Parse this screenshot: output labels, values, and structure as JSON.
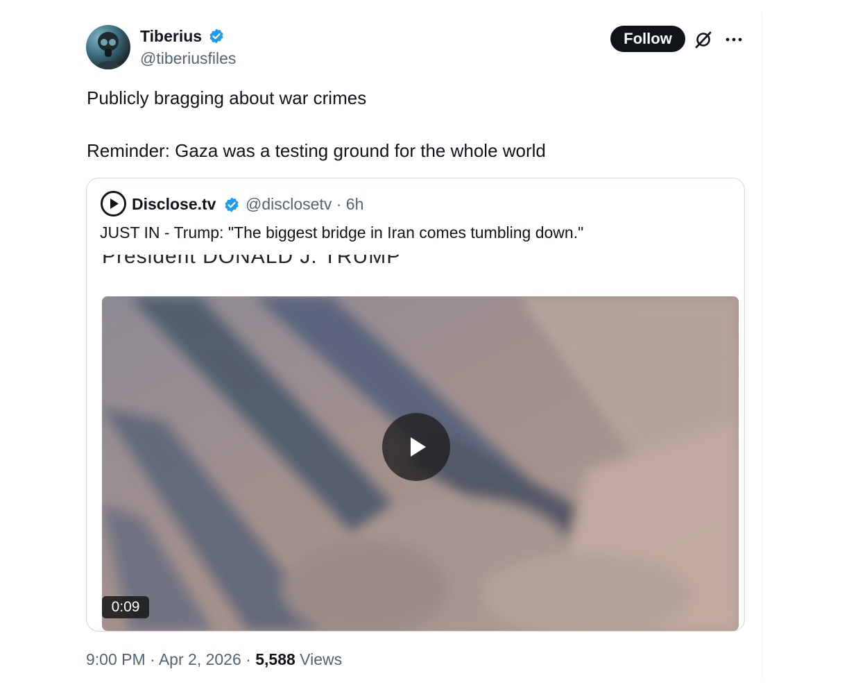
{
  "author": {
    "display_name": "Tiberius",
    "handle": "@tiberiusfiles",
    "verified": true,
    "avatar_icon": "gas-mask-avatar"
  },
  "header_actions": {
    "follow_label": "Follow",
    "grok_icon": "grok-icon",
    "more_icon": "more-dots-icon"
  },
  "tweet": {
    "text_line1": "Publicly bragging about war crimes",
    "text_line2": "Reminder: Gaza was a testing ground for the whole world"
  },
  "quote": {
    "display_name": "Disclose.tv",
    "handle": "@disclosetv",
    "separator": "·",
    "time": "6h",
    "verified": true,
    "text": "JUST IN - Trump: \"The biggest bridge in Iran comes tumbling down.\"",
    "video_caption": "President DONALD J. TRUMP",
    "video_duration": "0:09"
  },
  "footer": {
    "time": "9:00 PM",
    "separator": "·",
    "date": "Apr 2, 2026",
    "views_count": "5,588",
    "views_label": "Views"
  },
  "colors": {
    "verified_blue": "#1d9bf0",
    "follow_bg": "#0f1419",
    "secondary_text": "#536471",
    "border": "#cfd9de"
  }
}
